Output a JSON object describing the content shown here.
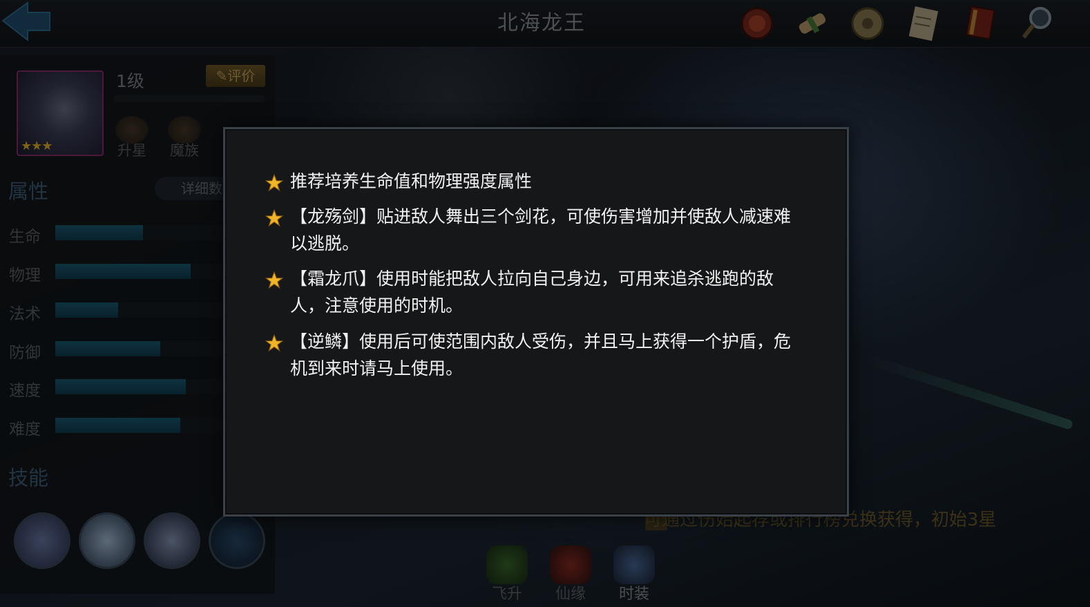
{
  "header": {
    "title": "北海龙王",
    "icons": [
      "seal-icon",
      "scroll-icon",
      "coin-icon",
      "letter-icon",
      "book-icon",
      "magnifier-icon"
    ]
  },
  "hero": {
    "level": "1级",
    "evaluate_label": "评价",
    "stars": "★★★",
    "sub_buttons": [
      "升星",
      "魔族"
    ]
  },
  "attributes": {
    "title": "属性",
    "detail_label": "详细数",
    "stats": [
      {
        "label": "生命",
        "value": 0.52
      },
      {
        "label": "物理",
        "value": 0.8
      },
      {
        "label": "法术",
        "value": 0.37
      },
      {
        "label": "防御",
        "value": 0.62
      },
      {
        "label": "速度",
        "value": 0.77
      },
      {
        "label": "难度",
        "value": 0.74
      }
    ]
  },
  "skills": {
    "title": "技能",
    "count": 4
  },
  "bottom": {
    "hint": "可通过伤始起荐或排行榜兑换获得，初始3星",
    "buttons": [
      "飞升",
      "仙缘",
      "时装"
    ]
  },
  "modal": {
    "tips": [
      "推荐培养生命值和物理强度属性",
      "【龙殇剑】贴进敌人舞出三个剑花，可使伤害增加并使敌人减速难以逃脱。",
      "【霜龙爪】使用时能把敌人拉向自己身边，可用来追杀逃跑的敌人，注意使用的时机。",
      "【逆鳞】使用后可使范围内敌人受伤，并且马上获得一个护盾，危机到来时请马上使用。"
    ]
  },
  "colors": {
    "accent_gold": "#e8b32c",
    "stat_bar": "#1b5b74",
    "section_title": "#3f5f7a"
  }
}
